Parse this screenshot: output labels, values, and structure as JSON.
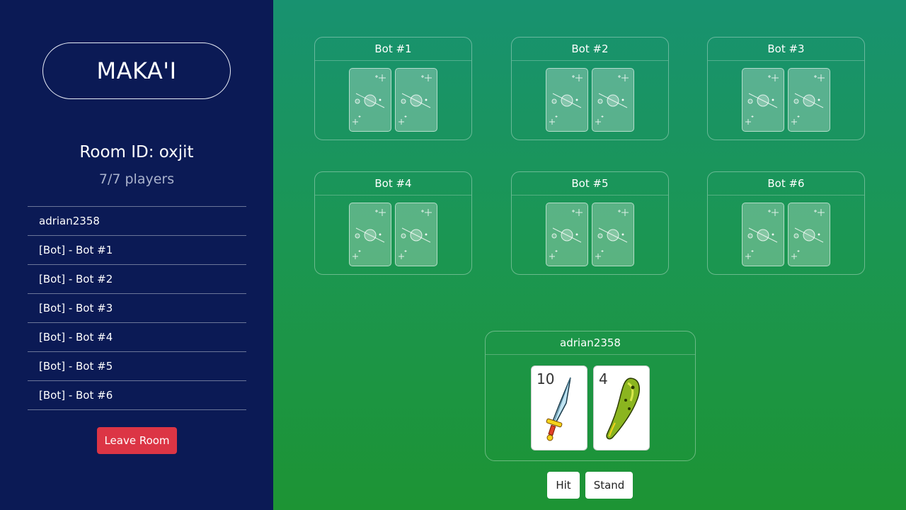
{
  "sidebar": {
    "logo": "MAKA'I",
    "room_id": "Room ID: oxjit",
    "player_count": "7/7 players",
    "players": [
      "adrian2358",
      "[Bot] - Bot #1",
      "[Bot] - Bot #2",
      "[Bot] - Bot #3",
      "[Bot] - Bot #4",
      "[Bot] - Bot #5",
      "[Bot] - Bot #6"
    ],
    "leave_label": "Leave Room"
  },
  "table": {
    "bots": [
      {
        "name": "Bot #1",
        "cards": 2
      },
      {
        "name": "Bot #2",
        "cards": 2
      },
      {
        "name": "Bot #3",
        "cards": 2
      },
      {
        "name": "Bot #4",
        "cards": 2
      },
      {
        "name": "Bot #5",
        "cards": 2
      },
      {
        "name": "Bot #6",
        "cards": 2
      }
    ],
    "me": {
      "name": "adrian2358",
      "cards": [
        {
          "rank": "10",
          "suit": "sword-icon"
        },
        {
          "rank": "4",
          "suit": "club-icon"
        }
      ]
    },
    "actions": {
      "hit": "Hit",
      "stand": "Stand"
    }
  },
  "colors": {
    "sidebar_bg": "#0b1a55",
    "leave_button": "#dc3545",
    "table_top": "#189270",
    "table_bottom": "#1d9434"
  }
}
